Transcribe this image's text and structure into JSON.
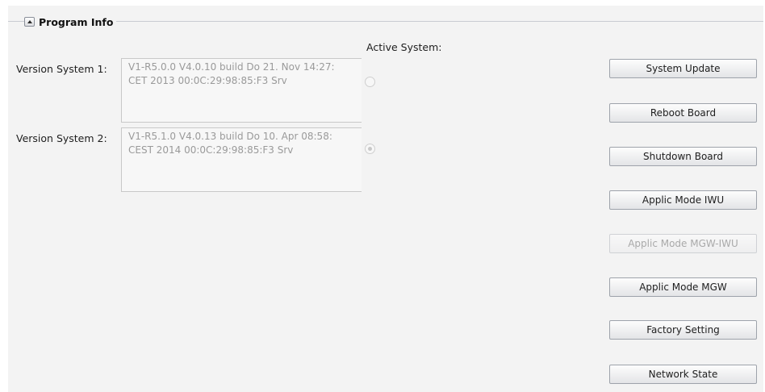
{
  "group": {
    "title": "Program Info"
  },
  "active_system": {
    "label": "Active System:",
    "selected": 2
  },
  "systems": [
    {
      "label": "Version System 1:",
      "line1": "V1-R5.0.0 V4.0.10 build Do 21. Nov 14:27:",
      "line2": "CET 2013 00:0C:29:98:85:F3 Srv"
    },
    {
      "label": "Version System 2:",
      "line1": "V1-R5.1.0 V4.0.13 build Do 10. Apr 08:58:",
      "line2": "CEST 2014 00:0C:29:98:85:F3 Srv"
    }
  ],
  "buttons": {
    "system_update": "System Update",
    "reboot_board": "Reboot Board",
    "shutdown_board": "Shutdown Board",
    "applic_mode_iwu": "Applic Mode IWU",
    "applic_mode_mgw_iwu": "Applic Mode MGW-IWU",
    "applic_mode_mgw": "Applic Mode MGW",
    "factory_setting": "Factory Setting",
    "network_state": "Network State"
  },
  "colors": {
    "panel_bg": "#f3f3f3",
    "disabled_text": "#9a9a9a",
    "group_line": "#c9ccd2"
  }
}
